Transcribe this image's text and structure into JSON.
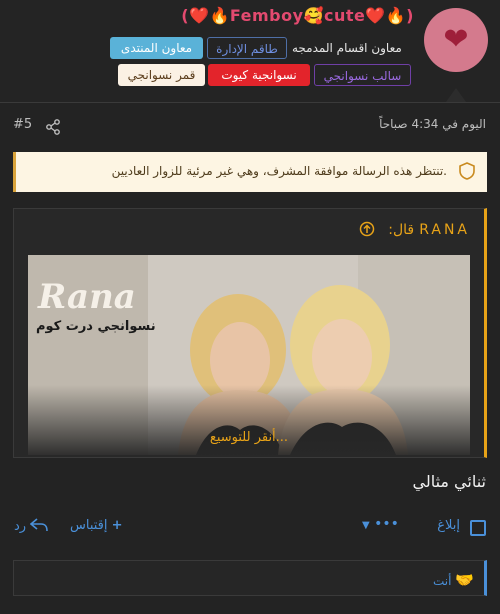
{
  "post": {
    "username": "(❤️🔥Femboy🥰cute❤️🔥)",
    "user_role": "معاون اقسام المدمجه",
    "badges": {
      "forum_moderator": "معاون المنتدى",
      "admin_staff": "طاقم الإدارة",
      "moon": "قمر نسوانجي",
      "cute": "نسوانجية كيوت",
      "salib": "سالب نسوانجي"
    },
    "time": "اليوم في 4:34 صباحاً",
    "number": "#5",
    "notice": "تنتظر هذه الرسالة موافقة المشرف، وهي غير مرئية للزوار العاديين.",
    "quote": {
      "author": "RANA",
      "said": "قال:",
      "expand": "أنقر للتوسيع...",
      "logo": "Rana",
      "logo_sub": "نسوانجي درت كوم"
    },
    "body": "ثنائي مثالي",
    "actions": {
      "report": "إبلاغ",
      "more": "•••",
      "quote": "إقتباس",
      "reply": "رد"
    },
    "reaction": "أنت"
  },
  "colors": {
    "accent": "#e8a318",
    "link": "#4a90d9",
    "bg": "#232323"
  }
}
